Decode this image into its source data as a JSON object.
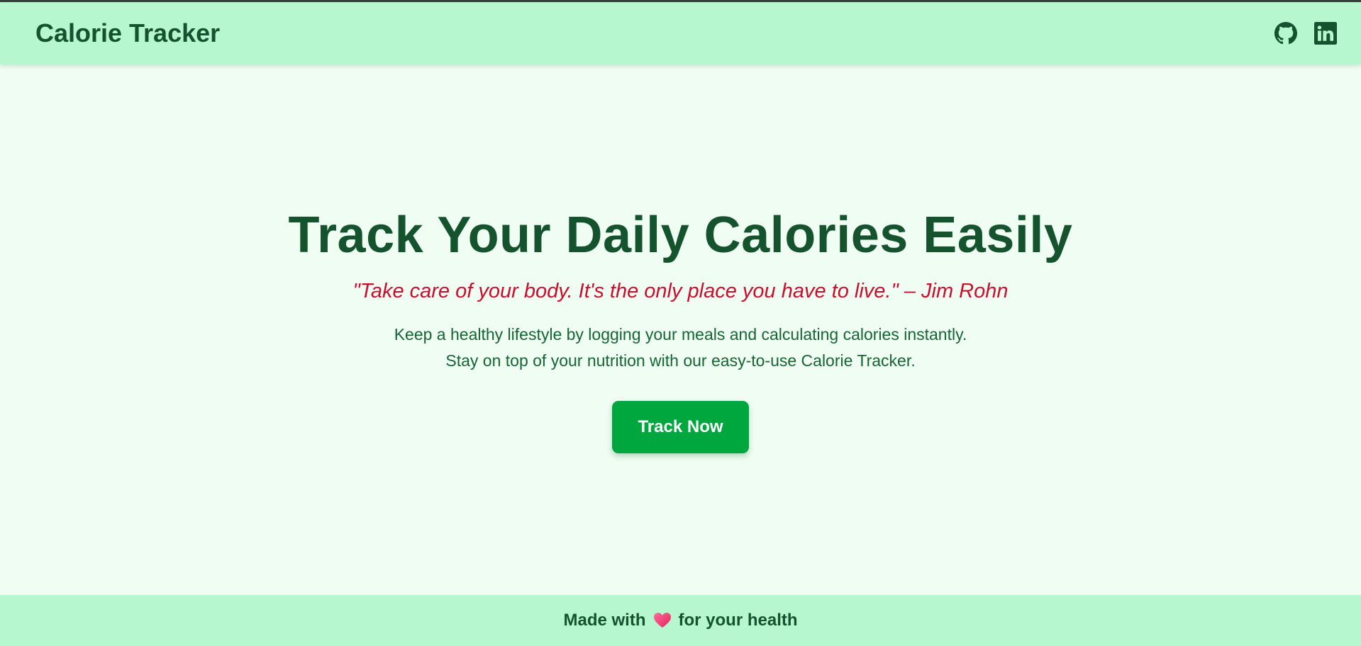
{
  "navbar": {
    "brand": "Calorie Tracker",
    "icons": [
      "github-icon",
      "linkedin-icon"
    ]
  },
  "hero": {
    "title": "Track Your Daily Calories Easily",
    "quote": "\"Take care of your body. It's the only place you have to live.\" – Jim Rohn",
    "description_line1": "Keep a healthy lifestyle by logging your meals and calculating calories instantly.",
    "description_line2": "Stay on top of your nutrition with our easy-to-use Calorie Tracker.",
    "cta_label": "Track Now"
  },
  "footer": {
    "text_before": "Made with",
    "icon": "heart-icon",
    "text_after": "for your health"
  },
  "colors": {
    "navbar_bg": "#b7f7cf",
    "page_bg": "#effdf3",
    "primary_text": "#14532d",
    "quote_text": "#c8102e",
    "cta_bg": "#00a63e"
  }
}
